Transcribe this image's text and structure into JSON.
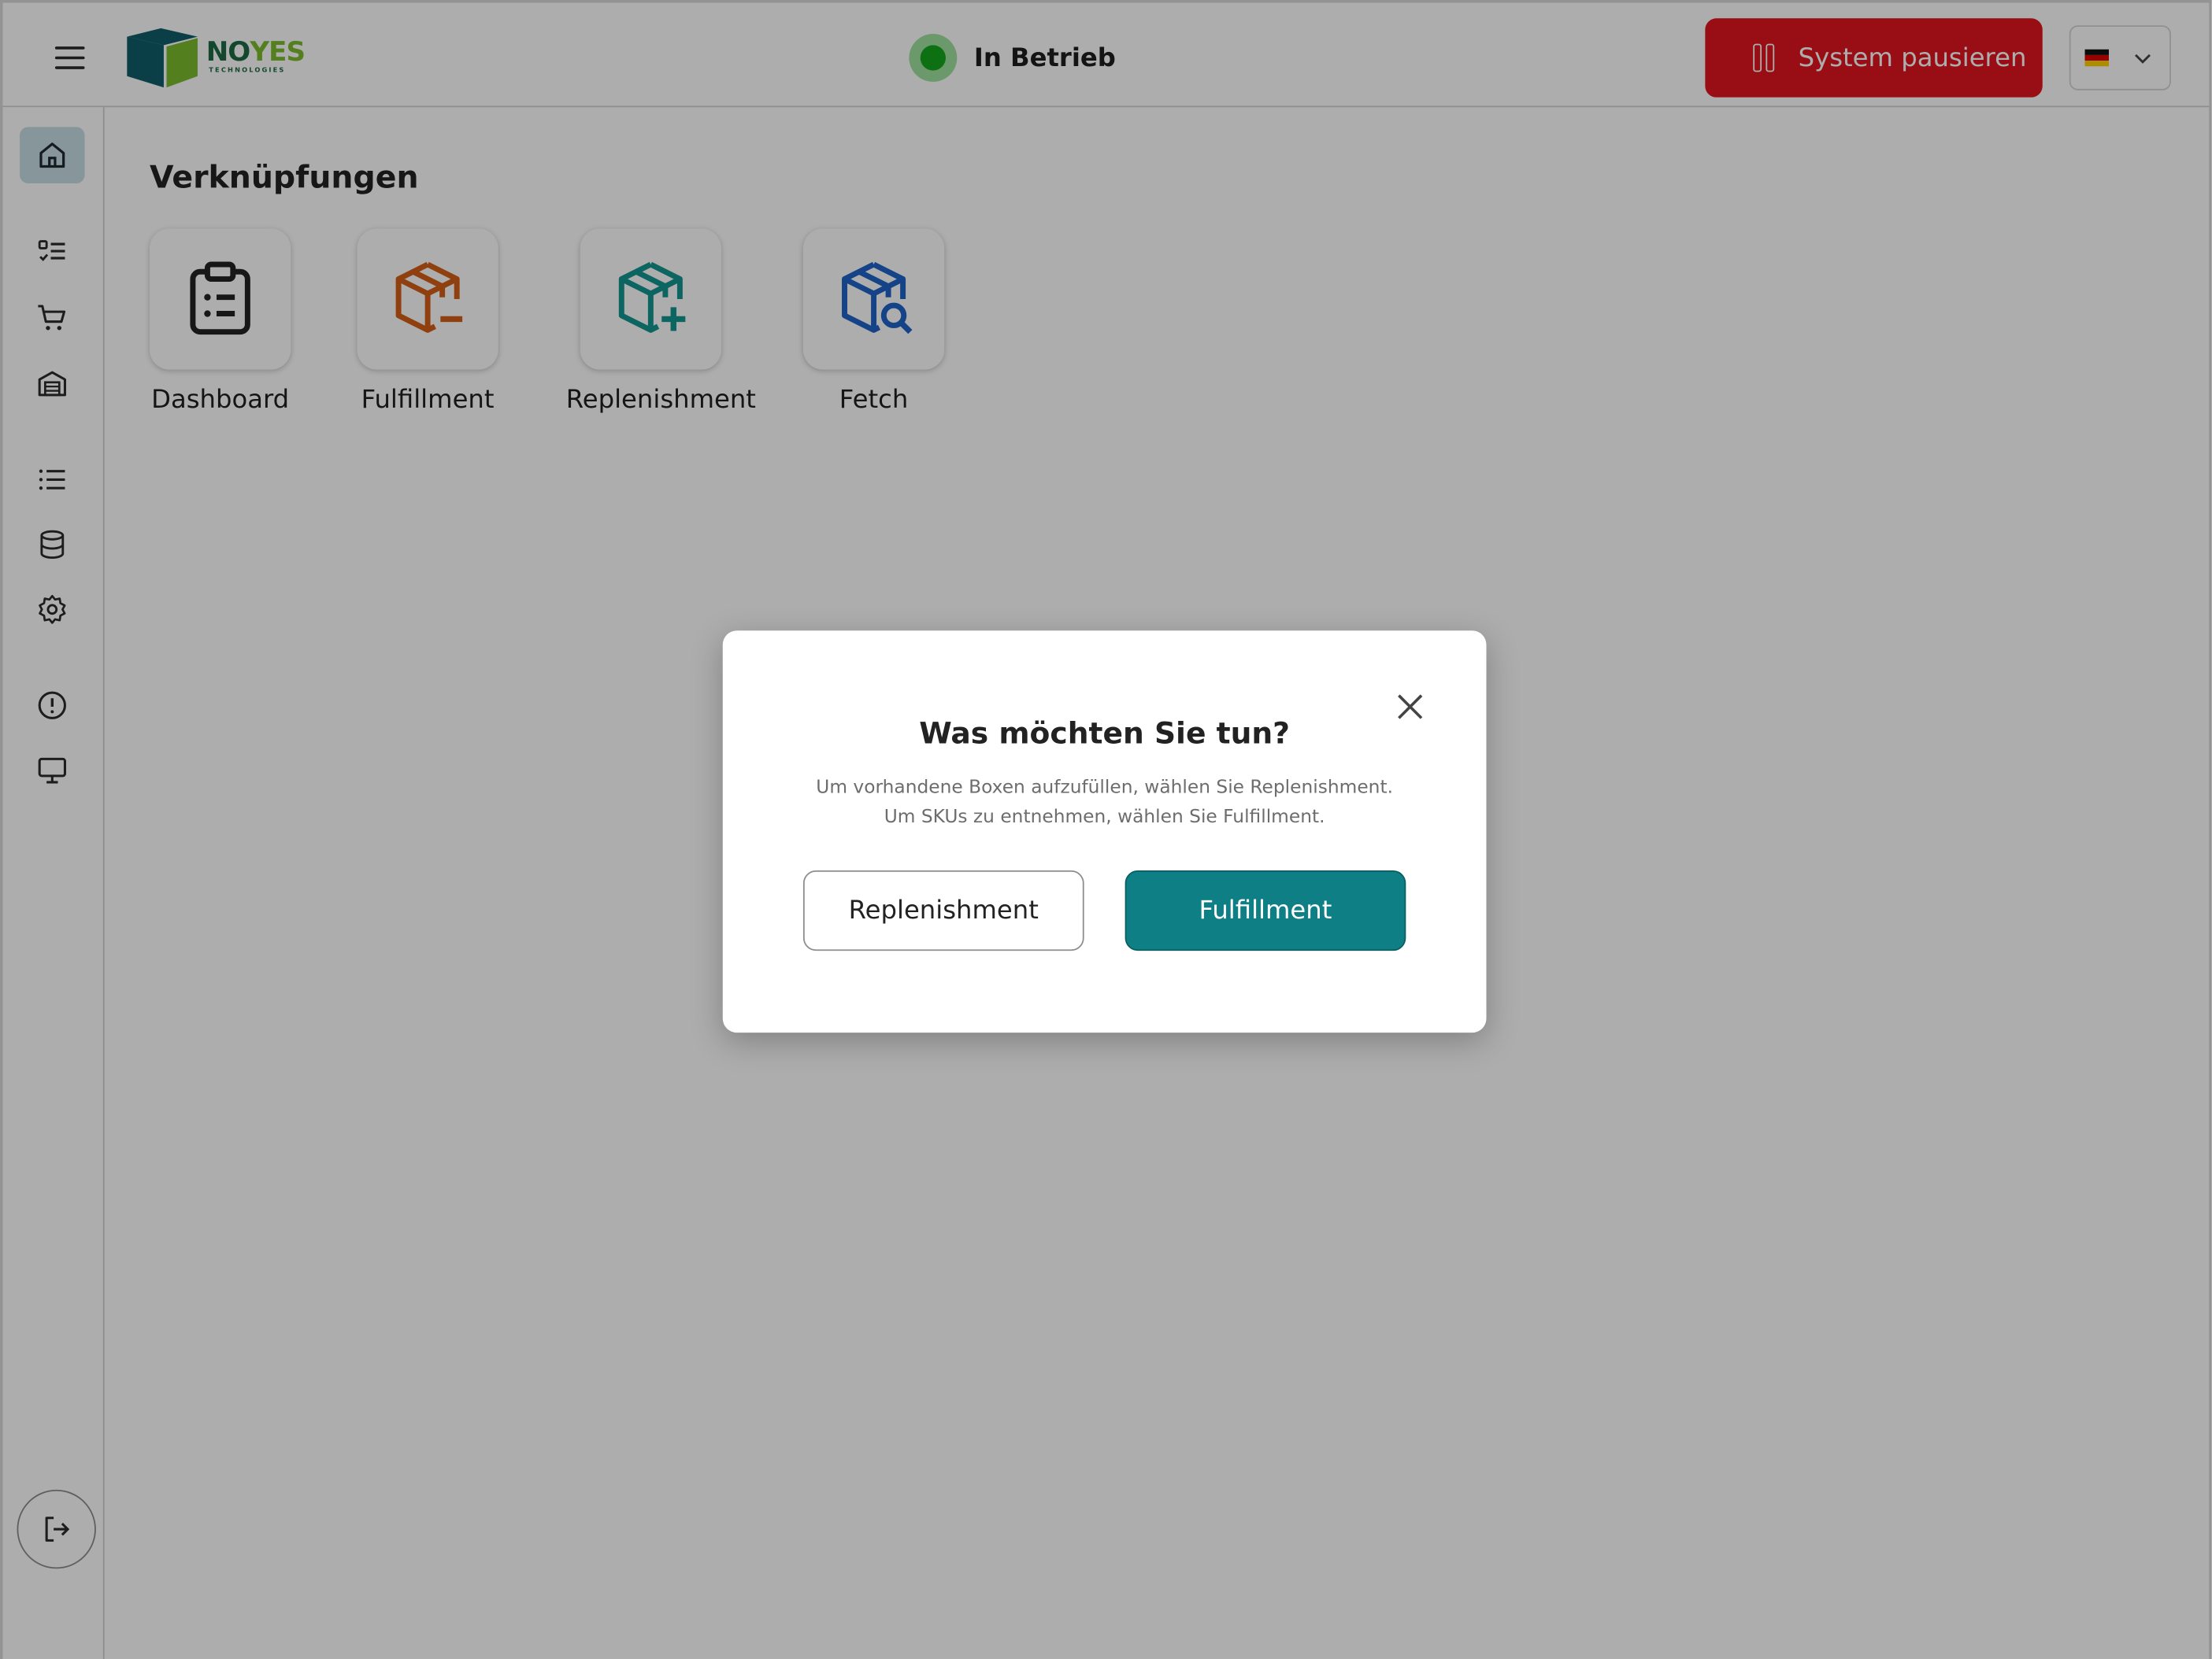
{
  "header": {
    "menu_icon": "hamburger-icon",
    "logo_text_a": "NO",
    "logo_text_b": "YES",
    "logo_subtext": "TECHNOLOGIES",
    "status_label": "In Betrieb",
    "status_color": "#14a51b",
    "pause_label": "System pausieren",
    "pause_color": "#e0161e",
    "language_flag": "de-flag-icon"
  },
  "sidebar": {
    "items": [
      {
        "icon": "home-icon",
        "active": true
      },
      {
        "icon": "task-list-icon",
        "active": false
      },
      {
        "icon": "cart-icon",
        "active": false
      },
      {
        "icon": "warehouse-icon",
        "active": false
      },
      {
        "icon": "list-icon",
        "active": false
      },
      {
        "icon": "database-icon",
        "active": false
      },
      {
        "icon": "gear-icon",
        "active": false
      },
      {
        "icon": "alert-icon",
        "active": false
      },
      {
        "icon": "monitor-icon",
        "active": false
      }
    ],
    "logout_icon": "logout-icon"
  },
  "main": {
    "section_title": "Verknüpfungen",
    "shortcuts": [
      {
        "label": "Dashboard",
        "icon": "clipboard-icon",
        "color": "#222222"
      },
      {
        "label": "Fulfillment",
        "icon": "package-minus-icon",
        "color": "#d35f16"
      },
      {
        "label": "Replenishment",
        "icon": "package-plus-icon",
        "color": "#13958f"
      },
      {
        "label": "Fetch",
        "icon": "package-search-icon",
        "color": "#1f63c8"
      }
    ]
  },
  "modal": {
    "title": "Was möchten Sie tun?",
    "description": "Um vorhandene Boxen aufzufüllen, wählen Sie Replenishment. Um SKUs zu entnehmen, wählen Sie Fulfillment.",
    "secondary_button": "Replenishment",
    "primary_button": "Fulfillment",
    "primary_color": "#0f7f86",
    "close_icon": "close-icon"
  }
}
